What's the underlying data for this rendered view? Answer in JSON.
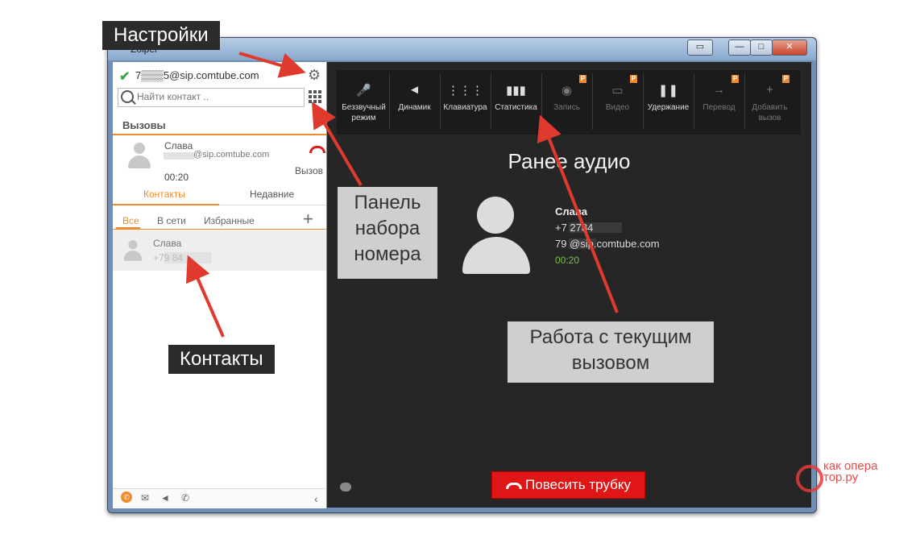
{
  "window": {
    "title": "Zoiper",
    "btn_min": "—",
    "btn_max": "□",
    "btn_close": "✕",
    "btn_extra": "▭"
  },
  "sidebar": {
    "account": "7▒▒▒5@sip.comtube.com",
    "search_placeholder": "Найти контакт ..",
    "calls_header": "Вызовы",
    "call": {
      "name": "Слава",
      "address": "@sip.comtube.com",
      "duration": "00:20",
      "type": "Вызов"
    },
    "tabs": [
      {
        "label": "Контакты"
      },
      {
        "label": "Недавние"
      }
    ],
    "subtabs": [
      {
        "label": "Все"
      },
      {
        "label": "В сети"
      },
      {
        "label": "Избранные"
      }
    ],
    "add_label": "+",
    "contact": {
      "name": "Слава",
      "number": "+79            84"
    },
    "footer_icons": [
      "phone-icon",
      "mail-icon",
      "speaker-icon",
      "call-forward-icon"
    ],
    "collapse": "‹"
  },
  "toolbar": {
    "buttons": [
      {
        "label": "Беззвучный режим",
        "icon": "mute-mic-icon",
        "glyph": "🎤",
        "enabled": true,
        "pro": false
      },
      {
        "label": "Динамик",
        "icon": "speaker-icon",
        "glyph": "◄",
        "enabled": true,
        "pro": false
      },
      {
        "label": "Клавиатура",
        "icon": "keypad-icon",
        "glyph": "⋮⋮⋮",
        "enabled": true,
        "pro": false
      },
      {
        "label": "Статистика",
        "icon": "stats-icon",
        "glyph": "▮▮▮",
        "enabled": true,
        "pro": false
      },
      {
        "label": "Запись",
        "icon": "record-icon",
        "glyph": "◉",
        "enabled": false,
        "pro": true
      },
      {
        "label": "Видео",
        "icon": "video-icon",
        "glyph": "▭",
        "enabled": false,
        "pro": true
      },
      {
        "label": "Удержание",
        "icon": "pause-icon",
        "glyph": "❚❚",
        "enabled": true,
        "pro": false
      },
      {
        "label": "Перевод",
        "icon": "transfer-icon",
        "glyph": "→",
        "enabled": false,
        "pro": true
      },
      {
        "label": "Добавить вызов",
        "icon": "add-call-icon",
        "glyph": "+",
        "enabled": false,
        "pro": true
      }
    ],
    "pro_badge": "P"
  },
  "call_panel": {
    "title": "Ранее аудио",
    "peer_name": "Слава",
    "peer_phone": "+7         2784",
    "peer_sip": "79         @sip.comtube.com",
    "duration": "00:20",
    "hangup_label": "Повесить трубку"
  },
  "annotations": {
    "settings": "Настройки",
    "dialpad": "Панель набора номера",
    "contacts": "Контакты",
    "current_call": "Работа с текущим вызовом"
  },
  "watermark": {
    "text": "как опера тор.ру"
  },
  "colors": {
    "accent": "#f08a2c",
    "hangup": "#e01515",
    "arrow": "#e03a2f",
    "duration": "#78c04a"
  }
}
